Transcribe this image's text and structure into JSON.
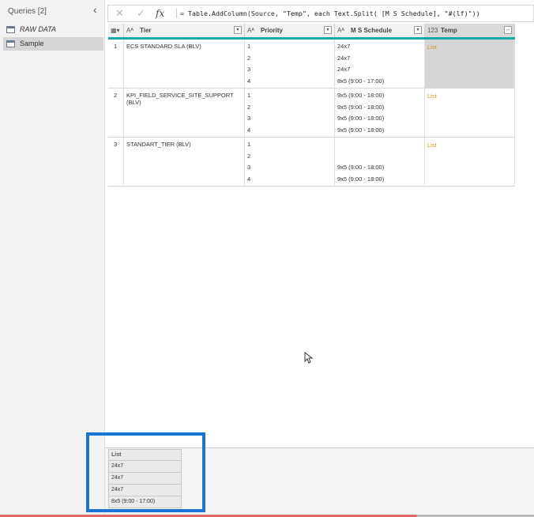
{
  "queries_pane": {
    "header": "Queries [2]",
    "collapse_icon": "‹",
    "items": [
      {
        "label": "RAW DATA",
        "icon": "table-icon"
      },
      {
        "label": "Sample",
        "icon": "table-icon"
      }
    ]
  },
  "formula_bar": {
    "cancel_icon": "✕",
    "commit_icon": "✓",
    "fx_icon": "fx",
    "formula": "= Table.AddColumn(Source, \"Temp\", each Text.Split( [M S Schedule], \"#(lf)\"))"
  },
  "grid": {
    "headers": {
      "corner_icon": "▦▾",
      "tier": {
        "type_icon": "Aᴬ",
        "label": "Tier"
      },
      "priority": {
        "type_icon": "Aᴬ",
        "label": "Priority"
      },
      "schedule": {
        "type_icon": "Aᴬ",
        "label": "M S Schedule"
      },
      "temp": {
        "type_icon": "123",
        "label": "Temp"
      }
    },
    "rows": [
      {
        "num": "1",
        "tier": "ECS STANDARD SLA (BLV)",
        "priority": [
          "1",
          "2",
          "3",
          "4"
        ],
        "schedule": [
          "24x7",
          "24x7",
          "24x7",
          "8x5 (9:00 - 17:00)"
        ],
        "temp": "List"
      },
      {
        "num": "2",
        "tier": "KPI_FIELD_SERVICE_SITE_SUPPORT (BLV)",
        "priority": [
          "1",
          "2",
          "3",
          "4"
        ],
        "schedule": [
          "9x5 (9:00 - 18:00)",
          "9x5 (9:00 - 18:00)",
          "9x5 (9:00 - 18:00)",
          "9x5 (9:00 - 18:00)"
        ],
        "temp": "List"
      },
      {
        "num": "3",
        "tier": "STANDART_TIER (BLV)",
        "priority": [
          "1",
          "2",
          "3",
          "4"
        ],
        "schedule": [
          "",
          "",
          "9x5 (9:00 - 18:00)",
          "9x5 (9:00 - 18:00)"
        ],
        "temp": "List"
      }
    ]
  },
  "preview": {
    "header": "List",
    "values": [
      "24x7",
      "24x7",
      "24x7",
      "8x5 (9:00 - 17:00)"
    ]
  },
  "colors": {
    "highlight_box": "#1a74d2",
    "quality_bar": "#1aa8a8",
    "list_link": "#c8961e"
  }
}
